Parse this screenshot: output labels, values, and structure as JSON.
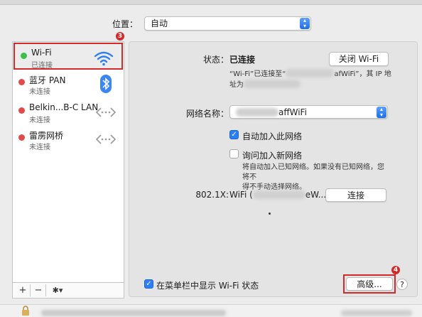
{
  "location": {
    "label": "位置：",
    "value": "自动"
  },
  "sidebar": {
    "services": [
      {
        "name": "Wi-Fi",
        "status": "已连接",
        "status_color": "#3cbe4b",
        "icon": "wifi-icon",
        "selected": true
      },
      {
        "name": "蓝牙 PAN",
        "status": "未连接",
        "status_color": "#e04a4a",
        "icon": "bluetooth-icon"
      },
      {
        "name": "Belkin...B-C LAN",
        "status": "未连接",
        "status_color": "#e04a4a",
        "icon": "ethernet-icon"
      },
      {
        "name": "雷雳网桥",
        "status": "未连接",
        "status_color": "#e04a4a",
        "icon": "ethernet-icon"
      }
    ],
    "toolbar": {
      "add": "+",
      "remove": "−",
      "gear": "✱▾"
    }
  },
  "annotations": {
    "badge_sidebar": "3",
    "badge_advanced": "4"
  },
  "main": {
    "status_label": "状态：",
    "status_value": "已连接",
    "turn_off_button": "关闭 Wi-Fi",
    "status_desc_1a": "“Wi-Fi”已连接至“",
    "status_desc_1b": "afWiFi”，其 IP 地",
    "status_desc_2a": "址为",
    "network_name_label": "网络名称：",
    "network_name_value": "affWiFi",
    "auto_join_label": "自动加入此网络",
    "ask_join_label": "询问加入新网络",
    "ask_join_desc_1": "将自动加入已知网络。如果没有已知网络，您将不",
    "ask_join_desc_2": "得不手动选择网络。",
    "dot8021x_label": "802.1X:",
    "dot8021x_value_a": "WiFi (",
    "dot8021x_value_b": "eW...",
    "connect_button": "连接",
    "show_status_label": "在菜单栏中显示 Wi-Fi 状态",
    "advanced_button": "高级...",
    "help_button": "?"
  },
  "colors": {
    "accent": "#2c7ef7",
    "annotation": "#d12a2a"
  }
}
